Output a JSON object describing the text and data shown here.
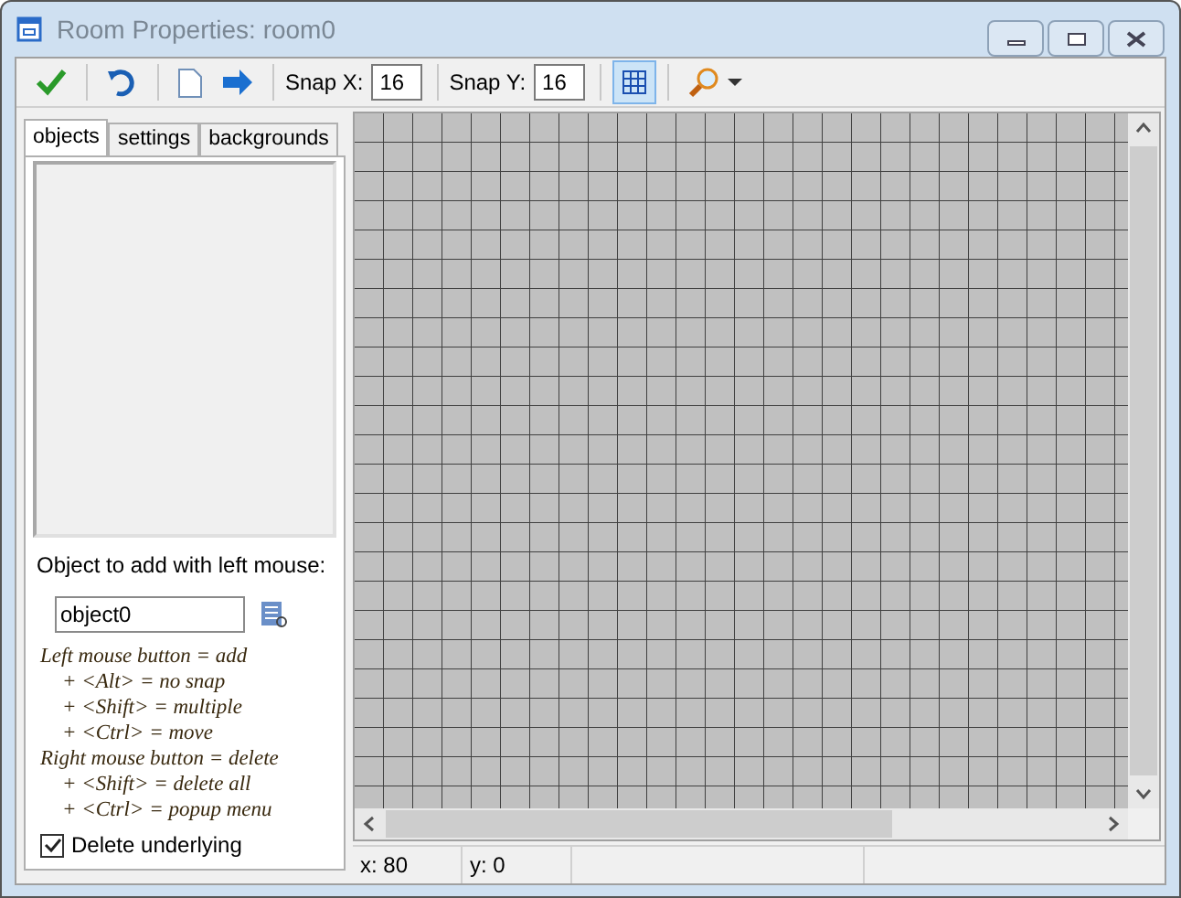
{
  "window": {
    "title": "Room Properties: room0"
  },
  "toolbar": {
    "snap_x": {
      "label": "Snap X:",
      "value": "16"
    },
    "snap_y": {
      "label": "Snap Y:",
      "value": "16"
    },
    "grid_on": true
  },
  "tabs": [
    {
      "label": "objects",
      "selected": true
    },
    {
      "label": "settings",
      "selected": false
    },
    {
      "label": "backgrounds",
      "selected": false
    }
  ],
  "object_panel": {
    "caption": "Object to add with left mouse:",
    "object_field": "object0",
    "help": [
      {
        "kind": "rule",
        "text": "Left mouse button = add"
      },
      {
        "kind": "modifier",
        "text": "+ <Alt> = no snap"
      },
      {
        "kind": "modifier",
        "text": "+ <Shift> = multiple"
      },
      {
        "kind": "modifier",
        "text": "+ <Ctrl> = move"
      },
      {
        "kind": "rule",
        "text": "Right mouse button = delete"
      },
      {
        "kind": "modifier",
        "text": "+ <Shift> = delete all"
      },
      {
        "kind": "modifier",
        "text": "+ <Ctrl> = popup menu"
      }
    ],
    "delete_underlying": {
      "label": "Delete underlying",
      "checked": true
    }
  },
  "status_bar": [
    "x: 80",
    "y: 0"
  ]
}
